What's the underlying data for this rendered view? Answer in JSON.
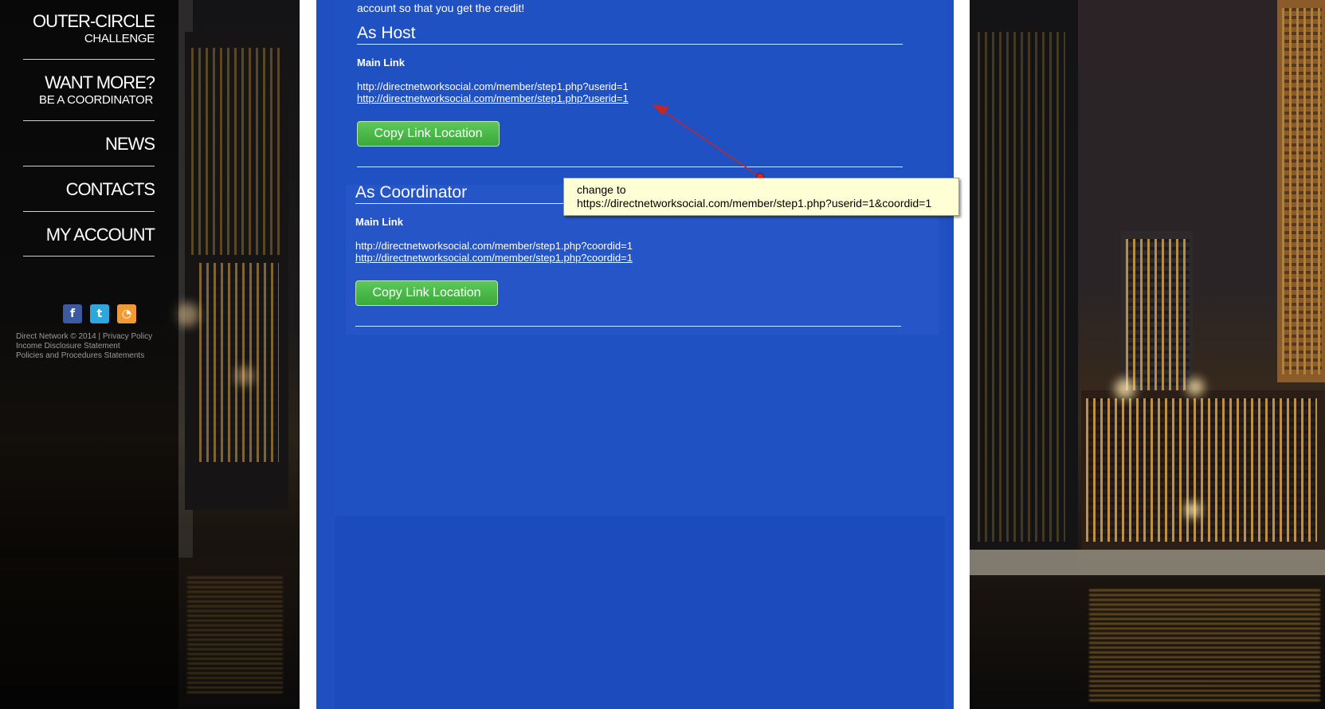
{
  "sidebar": {
    "brand_line1": "OUTER-CIRCLE",
    "brand_line2": "CHALLENGE",
    "want_more": "WANT MORE?",
    "be_coordinator": "BE A COORDINATOR",
    "news": "NEWS",
    "contacts": "CONTACTS",
    "my_account": "MY ACCOUNT",
    "social": {
      "facebook": "f",
      "twitter": "t",
      "rss": "◔"
    },
    "footer": {
      "line1": "Direct Network © 2014 | Privacy Policy",
      "line2": "Income Disclosure Statement",
      "line3": "Policies and Procedures Statements"
    }
  },
  "main": {
    "intro": "account so that you get the credit!",
    "host": {
      "heading": "As Host",
      "label": "Main Link",
      "url_text": "http://directnetworksocial.com/member/step1.php?userid=1",
      "url_link": "http://directnetworksocial.com/member/step1.php?userid=1",
      "button": "Copy Link Location"
    },
    "coordinator": {
      "heading": "As Coordinator",
      "label": "Main Link",
      "url_text": "http://directnetworksocial.com/member/step1.php?coordid=1",
      "url_link": "http://directnetworksocial.com/member/step1.php?coordid=1",
      "button": "Copy Link Location"
    }
  },
  "annotation": {
    "line1": "change to",
    "line2": "https://directnetworksocial.com/member/step1.php?userid=1&coordid=1"
  },
  "colors": {
    "main_blue": "#1f4fc0",
    "button_green": "#3aa93a",
    "note_yellow": "#ffffd6",
    "arrow_red": "#c0262a"
  }
}
